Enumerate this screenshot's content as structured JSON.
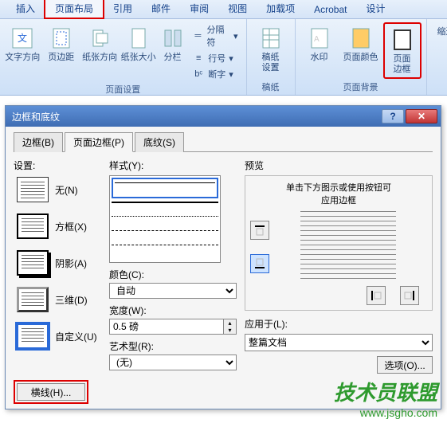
{
  "ribbon": {
    "tabs": [
      "插入",
      "页面布局",
      "引用",
      "邮件",
      "审阅",
      "视图",
      "加载项",
      "Acrobat",
      "设计"
    ],
    "active_tab": "页面布局",
    "groups": {
      "page_setup": {
        "label": "页面设置",
        "items": {
          "text_direction": "文字方向",
          "margins": "页边距",
          "orientation": "纸张方向",
          "size": "纸张大小",
          "columns": "分栏",
          "breaks": "分隔符",
          "line_numbers": "行号",
          "hyphenation": "断字"
        }
      },
      "paper": {
        "label": "稿纸",
        "items": {
          "settings": "稿纸\n设置"
        }
      },
      "background": {
        "label": "页面背景",
        "items": {
          "watermark": "水印",
          "page_color": "页面颜色",
          "page_border": "页面\n边框"
        }
      },
      "indent": {
        "label": "缩进"
      }
    }
  },
  "dialog": {
    "title": "边框和底纹",
    "tabs": {
      "border": "边框(B)",
      "page_border": "页面边框(P)",
      "shading": "底纹(S)"
    },
    "settings_label": "设置:",
    "settings": {
      "none": "无(N)",
      "box": "方框(X)",
      "shadow": "阴影(A)",
      "threeD": "三维(D)",
      "custom": "自定义(U)"
    },
    "style_label": "样式(Y):",
    "color_label": "颜色(C):",
    "color_value": "自动",
    "width_label": "宽度(W):",
    "width_value": "0.5 磅",
    "art_label": "艺术型(R):",
    "art_value": "(无)",
    "preview_label": "预览",
    "preview_hint": "单击下方图示或使用按钮可\n应用边框",
    "apply_label": "应用于(L):",
    "apply_value": "整篇文档",
    "options_btn": "选项(O)...",
    "horiz_line_btn": "横线(H)..."
  },
  "watermark": {
    "main": "技术员联盟",
    "url": "www.jsgho.com"
  }
}
